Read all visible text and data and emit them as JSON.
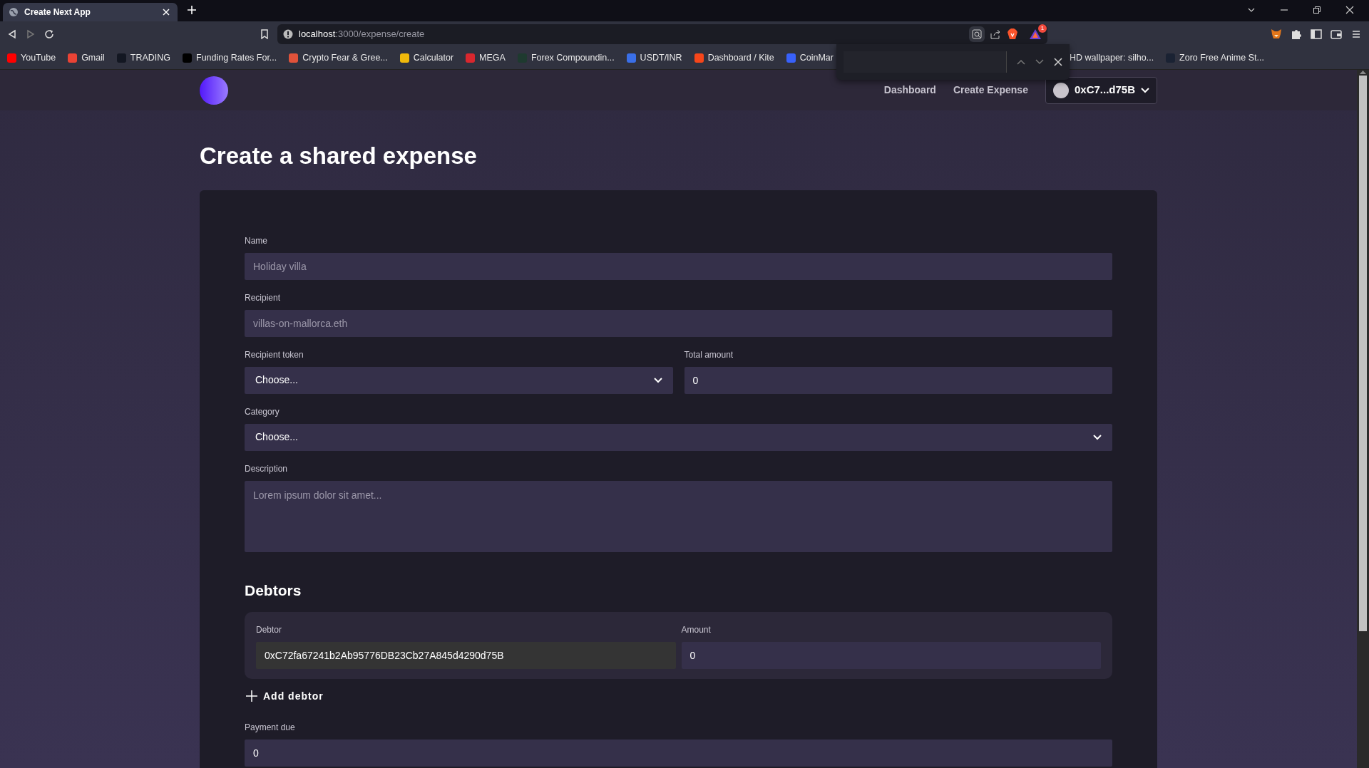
{
  "browser": {
    "tabs": [
      {
        "title": "Create Next App",
        "selected": true
      }
    ],
    "address": {
      "host": "localhost",
      "path": ":3000/expense/create"
    },
    "rewards_badge": "1",
    "bookmarks": [
      {
        "label": "YouTube",
        "color": "#ff0000"
      },
      {
        "label": "Gmail",
        "color": "#ea4335"
      },
      {
        "label": "TRADING",
        "color": "#131722"
      },
      {
        "label": "Funding Rates For...",
        "color": "#000000"
      },
      {
        "label": "Crypto Fear & Gree...",
        "color": "#e0523a"
      },
      {
        "label": "Calculator",
        "color": "#f0b90b"
      },
      {
        "label": "MEGA",
        "color": "#d9272e"
      },
      {
        "label": "Forex Compoundin...",
        "color": "#1e3a2f"
      },
      {
        "label": "USDT/INR",
        "color": "#3a6fe8"
      },
      {
        "label": "Dashboard / Kite",
        "color": "#f6461a"
      },
      {
        "label": "CoinMar",
        "color": "#3861fb"
      },
      {
        "label": "HD wallpaper: silho..."
      },
      {
        "label": "Zoro Free Anime St...",
        "color": "#1a2233"
      }
    ],
    "find_bar": {
      "open": true
    }
  },
  "nav": {
    "links": [
      "Dashboard",
      "Create Expense"
    ],
    "account": "0xC7...d75B"
  },
  "title": "Create a shared expense",
  "form": {
    "rows": [
      {
        "fields": [
          {
            "kind": "input",
            "label": "Name",
            "placeholder": "Holiday villa"
          }
        ]
      },
      {
        "fields": [
          {
            "kind": "input",
            "label": "Recipient",
            "placeholder": "villas-on-mallorca.eth"
          }
        ]
      },
      {
        "fields": [
          {
            "kind": "select",
            "label": "Recipient token",
            "value": "Choose..."
          },
          {
            "kind": "input",
            "label": "Total amount",
            "value": "0"
          }
        ]
      },
      {
        "fields": [
          {
            "kind": "select",
            "label": "Category",
            "value": "Choose..."
          }
        ]
      },
      {
        "fields": [
          {
            "kind": "textarea",
            "label": "Description",
            "placeholder": "Lorem ipsum dolor sit amet..."
          }
        ]
      }
    ]
  },
  "debtors": {
    "heading": "Debtors",
    "rows": [
      {
        "debtor_label": "Debtor",
        "debtor": "0xC72fa67241b2Ab95776DB23Cb27A845d4290d75B",
        "amount_label": "Amount",
        "amount": "0"
      }
    ],
    "add_button": "Add debtor"
  },
  "payment_due": {
    "label": "Payment due",
    "value": "0"
  }
}
